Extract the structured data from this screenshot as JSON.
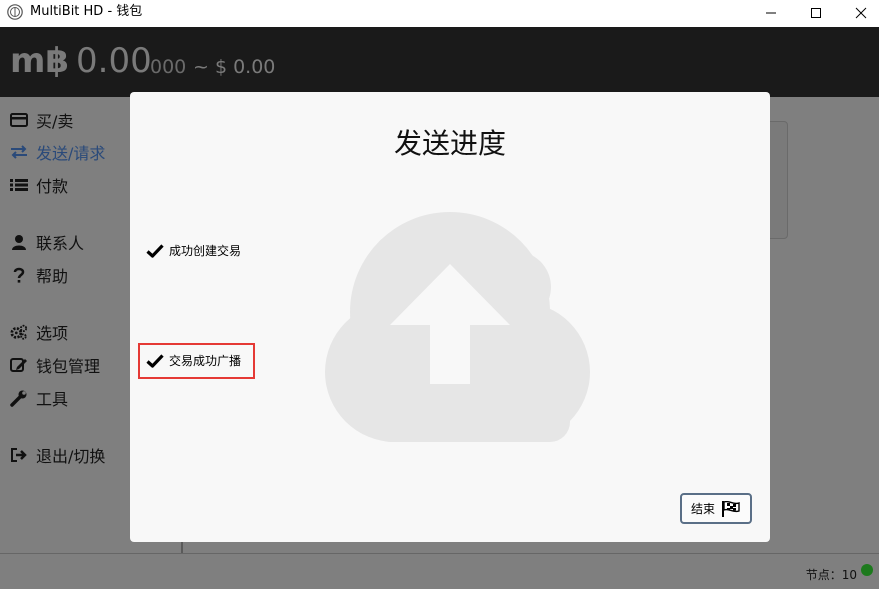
{
  "window": {
    "title": "MultiBit HD - 钱包",
    "minimize_icon": "minimize-icon",
    "maximize_icon": "maximize-icon",
    "close_icon": "close-icon"
  },
  "header": {
    "symbol": "m฿",
    "balance_main": "0.00",
    "balance_small": "000",
    "balance_fiat": "~ $ 0.00"
  },
  "sidebar": {
    "items": [
      {
        "label": "买/卖",
        "icon": "credit-card-icon"
      },
      {
        "label": "发送/请求",
        "icon": "exchange-arrows-icon",
        "active": true
      },
      {
        "label": "付款",
        "icon": "list-icon"
      },
      {
        "label": "联系人",
        "icon": "user-icon"
      },
      {
        "label": "帮助",
        "icon": "question-icon"
      },
      {
        "label": "选项",
        "icon": "cogs-icon"
      },
      {
        "label": "钱包管理",
        "icon": "edit-icon"
      },
      {
        "label": "工具",
        "icon": "wrench-icon"
      },
      {
        "label": "退出/切换",
        "icon": "sign-out-icon"
      }
    ]
  },
  "modal": {
    "title": "发送进度",
    "steps": [
      {
        "label": "成功创建交易",
        "status": "done"
      },
      {
        "label": "交易成功广播",
        "status": "done"
      }
    ],
    "finish_label": "结束",
    "graphic_icon": "cloud-upload-icon"
  },
  "statusbar": {
    "peers_text": "节点：10",
    "status_color": "#1d7a1d"
  },
  "colors": {
    "highlight": "#e53935",
    "active_nav": "#2a4a7a",
    "header_bg": "#1a1a1a"
  }
}
